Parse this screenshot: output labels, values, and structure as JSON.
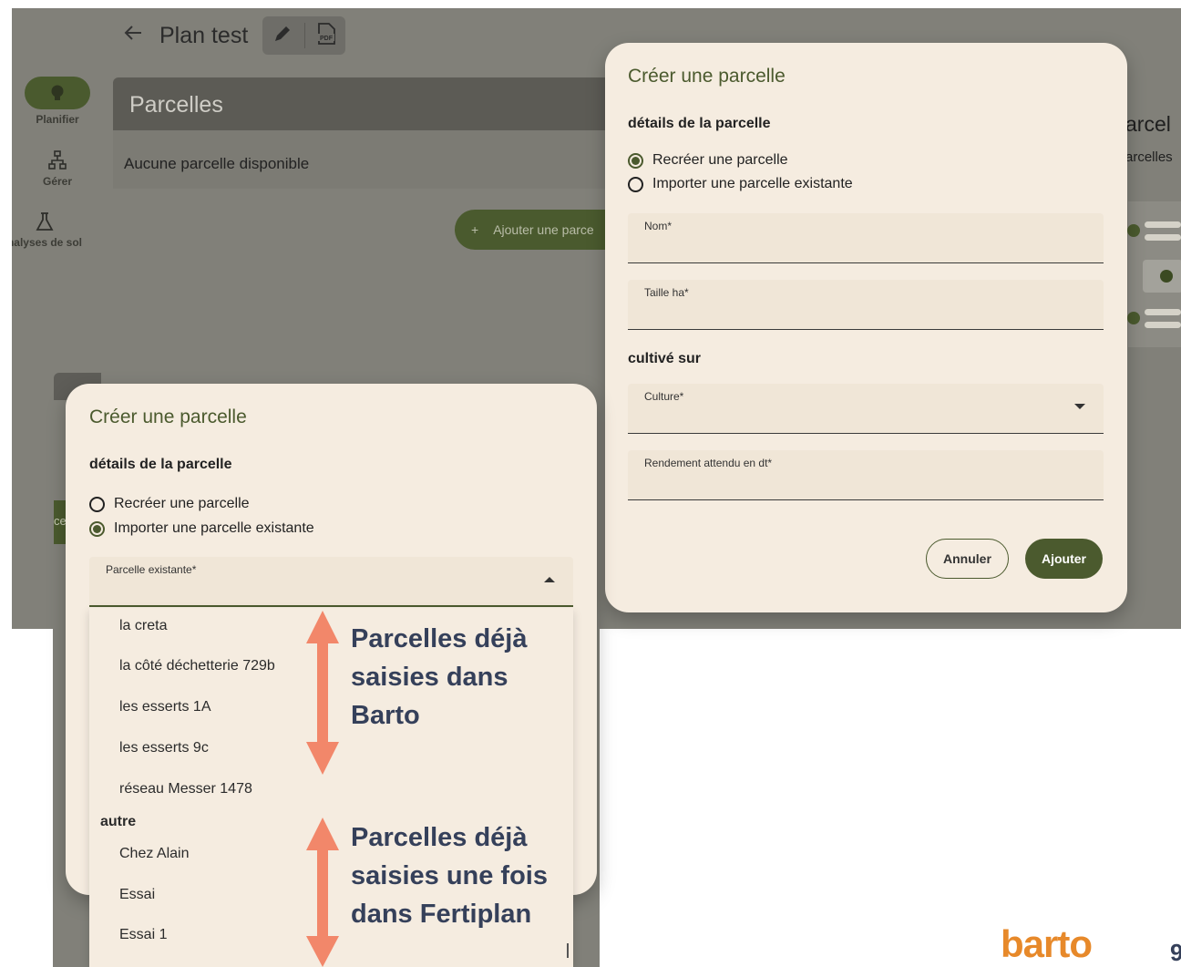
{
  "topbar": {
    "title": "Plan test"
  },
  "rail": [
    {
      "label": "Planifier"
    },
    {
      "label": "Gérer"
    },
    {
      "label": "nalyses de sol"
    }
  ],
  "background": {
    "parcels_header": "Parcelles",
    "no_parcel_text": "Aucune parcelle disponible",
    "add_parcel_label": "Ajouter une parce",
    "side_title": "arcel",
    "side_sub": "arcelles",
    "green_btn_text": "ce"
  },
  "dialog_right": {
    "title": "Créer une parcelle",
    "details_section": "détails de la parcelle",
    "radio_recreate": "Recréer une parcelle",
    "radio_import": "Importer une parcelle existante",
    "name_label": "Nom*",
    "size_label": "Taille ha*",
    "grown_on_section": "cultivé sur",
    "culture_label": "Culture*",
    "yield_label": "Rendement attendu en dt*",
    "cancel_label": "Annuler",
    "add_label": "Ajouter"
  },
  "dialog_left": {
    "title": "Créer une parcelle",
    "details_section": "détails de la parcelle",
    "radio_recreate": "Recréer une parcelle",
    "radio_import": "Importer une parcelle existante",
    "existing_label": "Parcelle existante*"
  },
  "dropdown": {
    "items_barto": [
      "la creta",
      "la côté déchetterie 729b",
      "les esserts 1A",
      "les esserts 9c",
      "réseau Messer 1478"
    ],
    "group_other": "autre",
    "items_other": [
      "Chez Alain",
      "Essai",
      "Essai 1"
    ]
  },
  "annotations": {
    "barto_lines": [
      "Parcelles déjà",
      "saisies dans",
      "Barto"
    ],
    "fertiplan_lines": [
      "Parcelles déjà",
      "saisies une fois",
      "dans Fertiplan"
    ]
  },
  "brand": "barto",
  "page_number": "9",
  "colors": {
    "primary": "#4b5a2e",
    "dialog_bg": "#f5ece0",
    "arrow": "#f2876a",
    "annotation": "#35405a",
    "brand": "#e7892a"
  }
}
